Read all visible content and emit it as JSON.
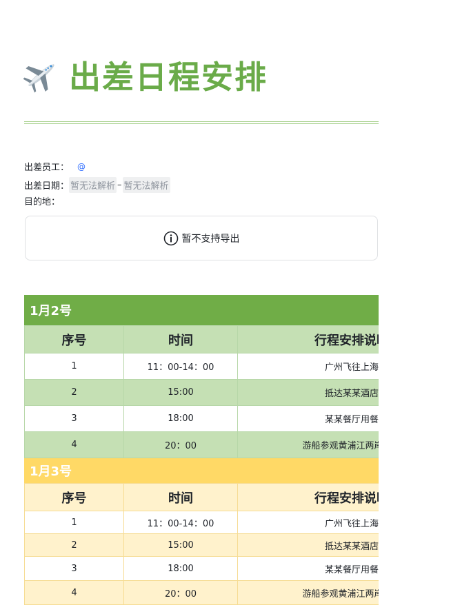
{
  "title": "出差日程安排",
  "colors": {
    "title": "#6aab49",
    "rule": "#a9d18e",
    "green_header": "#70ad47",
    "green_light": "#c5e0b4",
    "yellow_header": "#ffd966",
    "yellow_light": "#fff2cc"
  },
  "meta": {
    "employee_label": "出差员工：",
    "employee_value": "@",
    "date_label": "出差日期：",
    "date_start": "暂无法解析",
    "date_sep": "–",
    "date_end": "暂无法解析",
    "destination_label": "目的地："
  },
  "notice": {
    "icon": "info-icon",
    "text": "暂不支持导出"
  },
  "days": [
    {
      "label": "1月2号",
      "columns": [
        "序号",
        "时间",
        "行程安排说明"
      ],
      "rows": [
        [
          "1",
          "11：00-14：00",
          "广州飞往上海"
        ],
        [
          "2",
          "15:00",
          "抵达某某酒店"
        ],
        [
          "3",
          "18:00",
          "某某餐厅用餐"
        ],
        [
          "4",
          "20：00",
          "游船参观黄浦江两岸夜景"
        ]
      ]
    },
    {
      "label": "1月3号",
      "columns": [
        "序号",
        "时间",
        "行程安排说明"
      ],
      "rows": [
        [
          "1",
          "11：00-14：00",
          "广州飞往上海"
        ],
        [
          "2",
          "15:00",
          "抵达某某酒店"
        ],
        [
          "3",
          "18:00",
          "某某餐厅用餐"
        ],
        [
          "4",
          "20：00",
          "游船参观黄浦江两岸夜景"
        ]
      ]
    }
  ]
}
